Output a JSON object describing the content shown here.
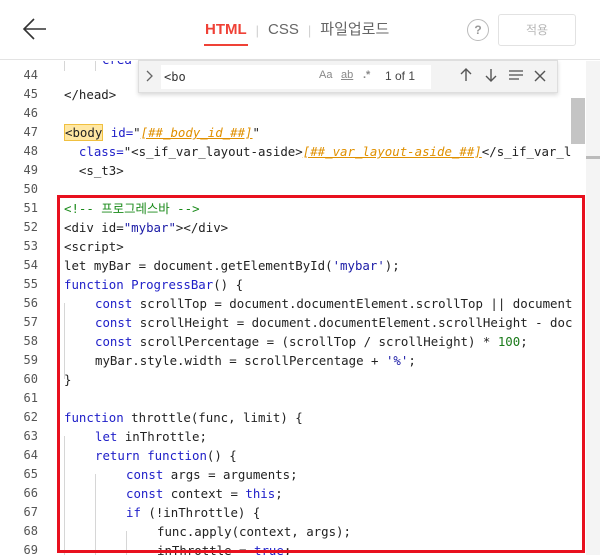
{
  "header": {
    "tabs": [
      {
        "label": "HTML",
        "active": true
      },
      {
        "label": "CSS",
        "active": false
      },
      {
        "label": "파일업로드",
        "active": false
      }
    ],
    "help_label": "?",
    "apply_label": "적용"
  },
  "search": {
    "query": "<bo",
    "opt_case": "Aa",
    "opt_word": "ab",
    "opt_regex": ".*",
    "count": "1 of 1"
  },
  "line_numbers": [
    "44",
    "45",
    "46",
    "47",
    "48",
    "49",
    "50",
    "51",
    "52",
    "53",
    "54",
    "55",
    "56",
    "57",
    "58",
    "59",
    "60",
    "61",
    "62",
    "63",
    "64",
    "65",
    "66",
    "67",
    "68",
    "69"
  ],
  "code": {
    "l43": "crea",
    "l45": "</head>",
    "l47_tag": "<body",
    "l47_attr": " id=",
    "l47_q1": "\"",
    "l47_tpl": "[##_body_id_##]",
    "l47_q2": "\"",
    "l48_attr": "  class=",
    "l48_q1": "\"",
    "l48_tag": "<s_if_var_layout-aside>",
    "l48_tpl": "[##_var_layout-aside_##]",
    "l48_end": "</s_if_var_l",
    "l49": "  <s_t3>",
    "l51": "<!-- 프로그레스바 -->",
    "l52_a": "<div id=",
    "l52_s": "\"mybar\"",
    "l52_b": "></div>",
    "l53": "<script>",
    "l54_a": "let myBar = document.getElementById(",
    "l54_s": "'mybar'",
    "l54_b": ");",
    "l55_kw": "function",
    "l55_fn": " ProgressBar",
    "l55_b": "() {",
    "l56_kw": "const",
    "l56_b": " scrollTop = document.documentElement.scrollTop || document",
    "l57_kw": "const",
    "l57_b": " scrollHeight = document.documentElement.scrollHeight - doc",
    "l58_kw": "const",
    "l58_b": " scrollPercentage = (scrollTop / scrollHeight) * ",
    "l58_n": "100",
    "l58_c": ";",
    "l59_a": "myBar.style.width = scrollPercentage + ",
    "l59_s": "'%'",
    "l59_b": ";",
    "l60": "}",
    "l62_kw": "function",
    "l62_b": " throttle(func, limit) {",
    "l63_kw": "let",
    "l63_b": " inThrottle;",
    "l64_kw": "return",
    "l64_kw2": " function",
    "l64_b": "() {",
    "l65_kw": "const",
    "l65_b": " args = arguments;",
    "l66_kw": "const",
    "l66_b": " context = ",
    "l66_kw2": "this",
    "l66_c": ";",
    "l67_kw": "if",
    "l67_b": " (!inThrottle) {",
    "l68": "func.apply(context, args);",
    "l69_a": "inThrottle = ",
    "l69_kw": "true",
    "l69_b": ";"
  }
}
